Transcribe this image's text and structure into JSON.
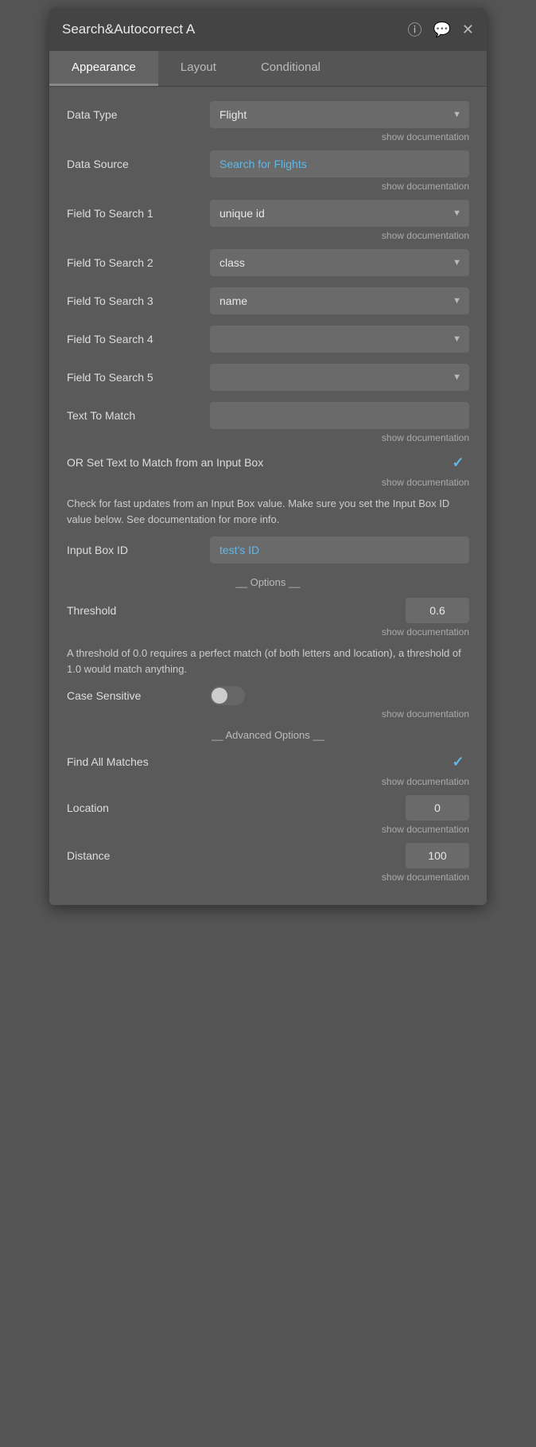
{
  "header": {
    "title": "Search&Autocorrect A",
    "info_icon": "ℹ",
    "comment_icon": "💬",
    "close_icon": "✕"
  },
  "tabs": [
    {
      "id": "appearance",
      "label": "Appearance",
      "active": true
    },
    {
      "id": "layout",
      "label": "Layout",
      "active": false
    },
    {
      "id": "conditional",
      "label": "Conditional",
      "active": false
    }
  ],
  "form": {
    "data_type": {
      "label": "Data Type",
      "value": "Flight",
      "options": [
        "Flight"
      ]
    },
    "data_source": {
      "label": "Data Source",
      "value": "Search for Flights",
      "doc_link": "show documentation"
    },
    "field1": {
      "label": "Field To Search 1",
      "value": "unique id",
      "options": [
        "unique id"
      ],
      "doc_link": "show documentation"
    },
    "field2": {
      "label": "Field To Search 2",
      "value": "class",
      "options": [
        "class"
      ]
    },
    "field3": {
      "label": "Field To Search 3",
      "value": "name",
      "options": [
        "name"
      ]
    },
    "field4": {
      "label": "Field To Search 4",
      "value": "",
      "options": []
    },
    "field5": {
      "label": "Field To Search 5",
      "value": "",
      "options": []
    },
    "text_to_match": {
      "label": "Text To Match",
      "value": "",
      "doc_link": "show documentation"
    },
    "or_set_text": {
      "label": "OR Set Text to Match from an Input Box",
      "checked": true,
      "doc_link": "show documentation"
    },
    "info_text": "Check for fast updates from an Input Box value. Make sure you set the Input Box ID value below. See documentation for more info.",
    "input_box_id": {
      "label": "Input Box ID",
      "value": "test's ID"
    },
    "options_divider": "__ Options __",
    "threshold": {
      "label": "Threshold",
      "value": "0.6",
      "doc_link": "show documentation"
    },
    "threshold_info": "A threshold of 0.0 requires a perfect match (of both letters and location), a threshold of 1.0 would match anything.",
    "case_sensitive": {
      "label": "Case Sensitive",
      "enabled": false,
      "doc_link": "show documentation"
    },
    "advanced_divider": "__ Advanced Options __",
    "find_all_matches": {
      "label": "Find All Matches",
      "checked": true,
      "doc_link": "show documentation"
    },
    "location": {
      "label": "Location",
      "value": "0",
      "doc_link": "show documentation"
    },
    "distance": {
      "label": "Distance",
      "value": "100",
      "doc_link": "show documentation"
    }
  }
}
